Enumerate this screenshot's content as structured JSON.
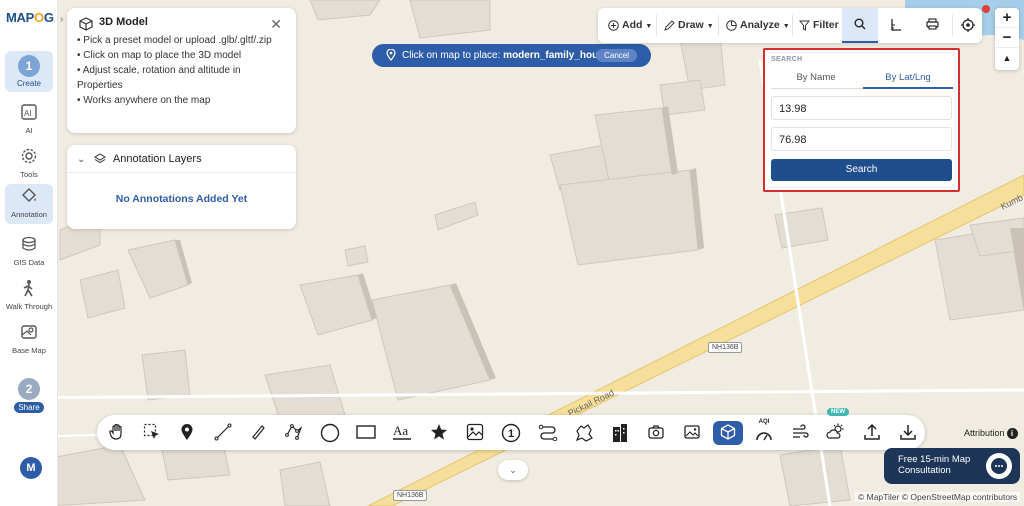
{
  "app": {
    "logo_prefix": "MAP",
    "logo_o": "O",
    "logo_suffix": "G"
  },
  "sidebar": {
    "step1": {
      "number": "1",
      "label": "Create"
    },
    "items": [
      {
        "label": "AI",
        "icon": "ai-icon"
      },
      {
        "label": "Tools",
        "icon": "gear-icon"
      },
      {
        "label": "Annotation",
        "icon": "paint-bucket-icon"
      },
      {
        "label": "GIS Data",
        "icon": "layers-icon"
      },
      {
        "label": "Walk Through",
        "icon": "walker-icon"
      },
      {
        "label": "Base Map",
        "icon": "map-icon"
      }
    ],
    "step2": {
      "number": "2",
      "label": "Share"
    },
    "avatar": "M"
  },
  "model_panel": {
    "title": "3D Model",
    "lines": [
      "• Pick a preset model or upload .glb/.gltf/.zip",
      "• Click on map to place the 3D model",
      "• Adjust scale, rotation and altitude in Properties",
      "• Works anywhere on the map"
    ]
  },
  "layers_panel": {
    "title": "Annotation Layers",
    "empty": "No Annotations Added Yet"
  },
  "banner": {
    "prefix": "Click on map to place:",
    "model": "modern_family_house",
    "cancel": "Cancel"
  },
  "toolbar": {
    "add": "Add",
    "draw": "Draw",
    "analyze": "Analyze",
    "filter": "Filter"
  },
  "zoom": {
    "in": "+",
    "out": "−",
    "compass": "▲"
  },
  "search": {
    "section": "SEARCH",
    "tab_name": "By Name",
    "tab_latlng": "By Lat/Lng",
    "lat": "13.98",
    "lng": "76.98",
    "button": "Search"
  },
  "map": {
    "road_name_1": "Kumb",
    "road_name_2": "Pickail Road",
    "shield_1": "NH136B",
    "shield_2": "NH136B",
    "attribution": "Attribution",
    "credits": "© MapTiler © OpenStreetMap contributors"
  },
  "drawbar": {
    "new_badge": "NEW",
    "aqi": "AQI"
  },
  "consult": {
    "line1": "Free 15-min Map",
    "line2": "Consultation"
  }
}
